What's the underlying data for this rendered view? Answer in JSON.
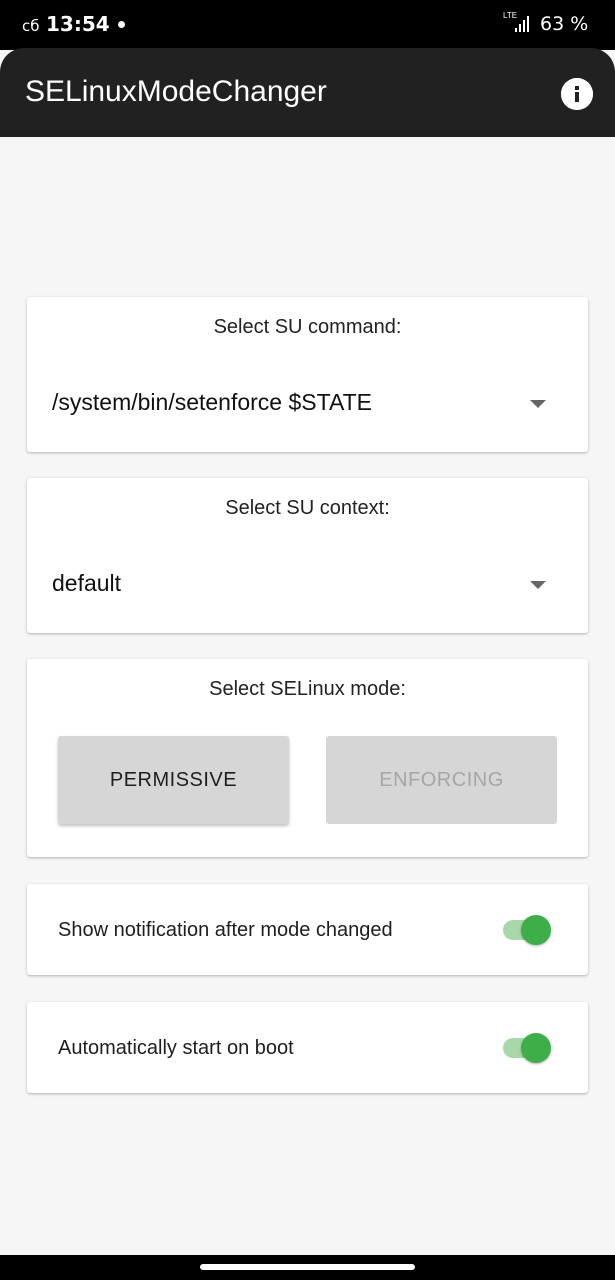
{
  "status_bar": {
    "day": "сб",
    "time": "13:54",
    "network": "LTE",
    "battery": "63 %"
  },
  "app_bar": {
    "title": "SELinuxModeChanger",
    "info_icon": "info-icon"
  },
  "su_command": {
    "title": "Select SU command:",
    "selected": "/system/bin/setenforce $STATE"
  },
  "su_context": {
    "title": "Select SU context:",
    "selected": "default"
  },
  "selinux_mode": {
    "title": "Select SELinux mode:",
    "permissive_label": "PERMISSIVE",
    "enforcing_label": "ENFORCING",
    "current": "enforcing"
  },
  "settings": {
    "notification_label": "Show notification after mode changed",
    "notification_enabled": true,
    "boot_label": "Automatically start on boot",
    "boot_enabled": true
  },
  "colors": {
    "app_bar_bg": "#212121",
    "background": "#f6f6f6",
    "switch_on": "#3eae49",
    "switch_track_on": "#a8d7a9",
    "button_bg": "#d6d6d6",
    "disabled_text": "#a6a6a6"
  }
}
